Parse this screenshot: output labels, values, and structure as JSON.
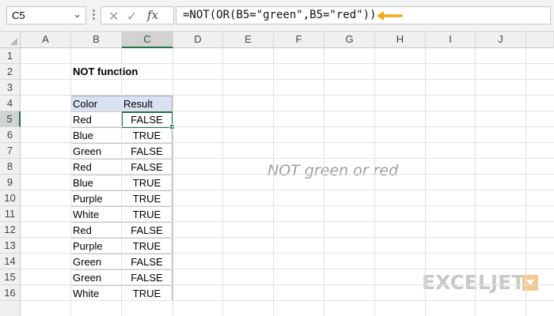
{
  "formula_bar": {
    "name_box": "C5",
    "cancel_icon": "✕",
    "enter_icon": "✓",
    "fx_label": "fx",
    "formula": "=NOT(OR(B5=\"green\",B5=\"red\"))",
    "arrow_color": "#f2a818"
  },
  "columns": [
    "A",
    "B",
    "C",
    "D",
    "E",
    "F",
    "G",
    "H",
    "I",
    "J"
  ],
  "rows": [
    "1",
    "2",
    "3",
    "4",
    "5",
    "6",
    "7",
    "8",
    "9",
    "10",
    "11",
    "12",
    "13",
    "14",
    "15",
    "16"
  ],
  "selected": {
    "column": "C",
    "row": "5"
  },
  "sheet": {
    "title": "NOT function",
    "table": {
      "headers": [
        "Color",
        "Result"
      ],
      "rows": [
        [
          "Red",
          "FALSE"
        ],
        [
          "Blue",
          "TRUE"
        ],
        [
          "Green",
          "FALSE"
        ],
        [
          "Red",
          "FALSE"
        ],
        [
          "Blue",
          "TRUE"
        ],
        [
          "Purple",
          "TRUE"
        ],
        [
          "White",
          "TRUE"
        ],
        [
          "Red",
          "FALSE"
        ],
        [
          "Purple",
          "TRUE"
        ],
        [
          "Green",
          "FALSE"
        ],
        [
          "Green",
          "FALSE"
        ],
        [
          "White",
          "TRUE"
        ]
      ]
    },
    "note": "NOT green or red"
  },
  "logo": {
    "text": "EXCELJET"
  },
  "colors": {
    "accent": "#217346",
    "header_fill": "#d9e1f2",
    "logo_mark": "#f4c892"
  }
}
